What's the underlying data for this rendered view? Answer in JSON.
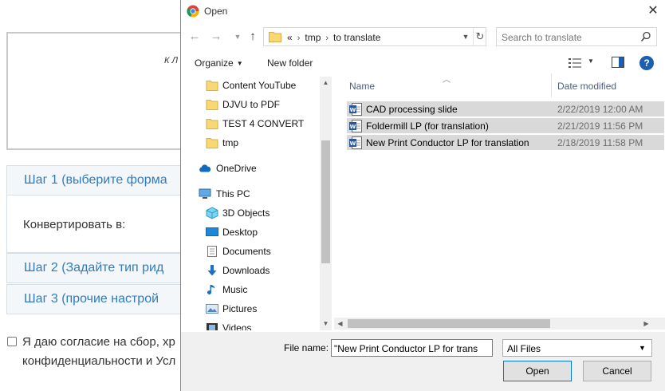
{
  "background_page": {
    "drop_text": "К Л",
    "step1": "Шаг 1 (выберите форма",
    "convert_label": "Конвертировать в:",
    "step2": "Шаг 2 (Задайте тип рид",
    "step3": "Шаг 3 (прочие настрой",
    "consent_line1": "Я даю согласие на сбор, хр",
    "consent_line2": "конфиденциальности и Усл"
  },
  "dialog": {
    "title": "Open",
    "close": "✕"
  },
  "address": {
    "prefix": "«",
    "crumbs": [
      "tmp",
      "to translate"
    ]
  },
  "search": {
    "placeholder": "Search to translate"
  },
  "toolbar": {
    "organize": "Organize",
    "new_folder": "New folder",
    "help": "?"
  },
  "nav_tree": [
    {
      "label": "Content YouTube",
      "icon": "folder-icon"
    },
    {
      "label": "DJVU to PDF",
      "icon": "folder-icon"
    },
    {
      "label": "TEST 4 CONVERT",
      "icon": "folder-icon"
    },
    {
      "label": "tmp",
      "icon": "folder-icon"
    },
    {
      "label": "OneDrive",
      "icon": "cloud-icon"
    },
    {
      "label": "This PC",
      "icon": "computer-icon"
    },
    {
      "label": "3D Objects",
      "icon": "cube-icon"
    },
    {
      "label": "Desktop",
      "icon": "desktop-icon"
    },
    {
      "label": "Documents",
      "icon": "documents-icon"
    },
    {
      "label": "Downloads",
      "icon": "download-icon"
    },
    {
      "label": "Music",
      "icon": "music-icon"
    },
    {
      "label": "Pictures",
      "icon": "pictures-icon"
    },
    {
      "label": "Videos",
      "icon": "videos-icon"
    }
  ],
  "columns": {
    "name": "Name",
    "date": "Date modified"
  },
  "files": [
    {
      "name": "CAD processing slide",
      "date": "2/22/2019 12:00 AM"
    },
    {
      "name": "Foldermill LP (for translation)",
      "date": "2/21/2019 11:56 PM"
    },
    {
      "name": "New Print Conductor LP for translation",
      "date": "2/18/2019 11:58 PM"
    }
  ],
  "bottom": {
    "file_name_label": "File name:",
    "file_name_value": "\"New Print Conductor LP for trans",
    "file_type": "All Files",
    "open": "Open",
    "cancel": "Cancel"
  },
  "colors": {
    "link_blue": "#2f7bbd",
    "selection": "#d9d9d9",
    "help_blue": "#1c5fb0",
    "folder_yellow": "#f8d775",
    "word_blue": "#2b579a"
  }
}
